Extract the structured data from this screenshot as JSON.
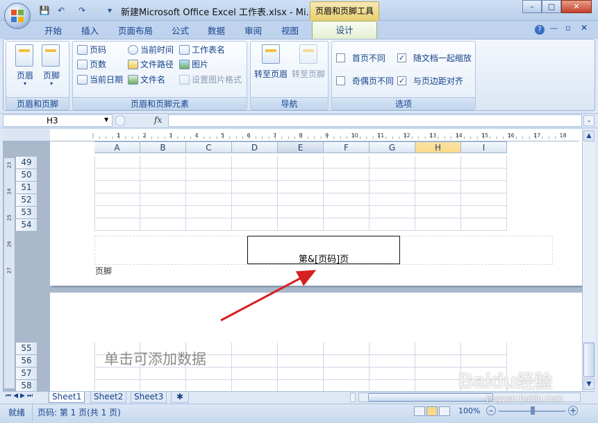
{
  "app": {
    "title": "新建Microsoft Office Excel 工作表.xlsx - Mi...",
    "tool_tab": "页眉和页脚工具",
    "window_buttons": [
      "–",
      "□",
      "✕"
    ]
  },
  "tabs": [
    "开始",
    "插入",
    "页面布局",
    "公式",
    "数据",
    "审阅",
    "视图"
  ],
  "active_tab": "设计",
  "ribbon": {
    "groups": [
      {
        "label": "页眉和页脚",
        "buttons": [
          "页眉",
          "页脚"
        ]
      },
      {
        "label": "页眉和页脚元素",
        "buttons": [
          "页码",
          "当前时间",
          "工作表名",
          "页数",
          "文件路径",
          "图片",
          "当前日期",
          "文件名",
          "设置图片格式"
        ]
      },
      {
        "label": "导航",
        "buttons": [
          "转至页眉",
          "转至页脚"
        ]
      },
      {
        "label": "选项",
        "checkboxes": [
          {
            "label": "首页不同",
            "checked": false
          },
          {
            "label": "随文档一起缩放",
            "checked": true
          },
          {
            "label": "奇偶页不同",
            "checked": false
          },
          {
            "label": "与页边距对齐",
            "checked": true
          }
        ]
      }
    ]
  },
  "formula_bar": {
    "name_box": "H3",
    "fx": "fx",
    "value": ""
  },
  "columns": [
    "A",
    "B",
    "C",
    "D",
    "E",
    "F",
    "G",
    "H",
    "I"
  ],
  "rows_page1": [
    "49",
    "50",
    "51",
    "52",
    "53",
    "54"
  ],
  "rows_page2": [
    "55",
    "56",
    "57",
    "58"
  ],
  "ruler_numbers": [
    "1",
    "2",
    "3",
    "4",
    "5",
    "6",
    "7",
    "8",
    "9",
    "10",
    "11",
    "12",
    "13",
    "14",
    "15",
    "16",
    "17",
    "18"
  ],
  "vruler_numbers": [
    "23",
    "24",
    "25",
    "26",
    "27"
  ],
  "footer": {
    "text": "第&[页码]页",
    "label": "页脚"
  },
  "page2_hint": "单击可添加数据",
  "sheets": [
    "Sheet1",
    "Sheet2",
    "Sheet3"
  ],
  "status": {
    "mode": "就绪",
    "page": "页码: 第 1 页(共 1 页)",
    "zoom": "100%"
  },
  "watermark": {
    "brand": "Baidu",
    "cn": "经验",
    "url": "jingyan.baidu.com"
  },
  "colors": {
    "accent": "#15428b",
    "arrow": "#d42020",
    "selected_col": "#f9d98a"
  }
}
